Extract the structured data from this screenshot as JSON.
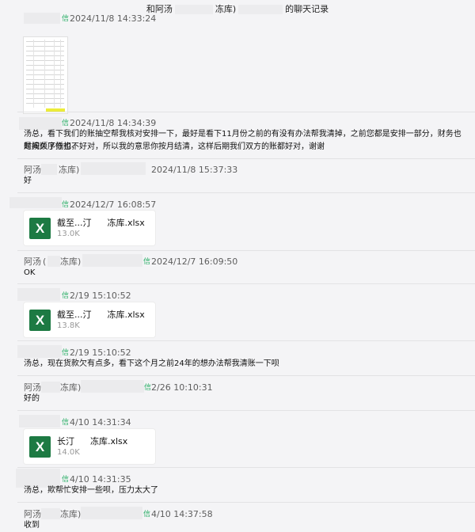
{
  "window": {
    "title": "和阿汤 冻库) 的聊天记录",
    "title_prefix": "和阿汤",
    "title_mid": "冻库)",
    "title_suffix": "的聊天记录"
  },
  "colors": {
    "background": "#f4f4f6",
    "file_icon": "#1d7a43",
    "wechat_tag": "#2aae67"
  },
  "messages": [
    {
      "id": "m1",
      "sender": "",
      "wx": "信",
      "time": "2024/11/8 14:33:24",
      "type": "image"
    },
    {
      "id": "m2",
      "sender": "",
      "wx": "信",
      "time": "2024/11/8 14:34:39",
      "type": "text",
      "line1": "汤总，看下我们的账抽空帮我核对安排一下，最好是看下11月份之前的有没有办法帮我清掉，之前您都是安排一部分，财务也是按顺序抵扣，",
      "line2": "时间久了你也不好对，所以我的意思你按月结清，这样后期我们双方的账都好对，谢谢"
    },
    {
      "id": "m3",
      "sender": "阿汤",
      "sender_mid": "冻库)",
      "time": "2024/11/8 15:37:33",
      "type": "text",
      "text": "好"
    },
    {
      "id": "m4",
      "sender": "",
      "wx": "信",
      "time": "2024/12/7 16:08:57",
      "type": "file",
      "file": {
        "name": "截至...汀",
        "name_end": "冻库.xlsx",
        "size": "13.0K",
        "icon": "X"
      }
    },
    {
      "id": "m5",
      "sender": "阿汤",
      "sender_mid": "(",
      "sender_mid2": "冻库)",
      "wx": "信",
      "time": "2024/12/7 16:09:50",
      "type": "text",
      "text": "OK"
    },
    {
      "id": "m6",
      "sender": "",
      "wx": "信",
      "time": "2/19 15:10:52",
      "type": "file",
      "file": {
        "name": "截至...汀",
        "name_end": "冻库.xlsx",
        "size": "13.8K",
        "icon": "X"
      }
    },
    {
      "id": "m7",
      "sender": "",
      "wx": "信",
      "time": "2/19 15:10:52",
      "type": "text",
      "text": "汤总，现在货款欠有点多，看下这个月之前24年的想办法帮我清账一下呗"
    },
    {
      "id": "m8",
      "sender": "阿汤",
      "sender_mid": "冻库)",
      "wx": "信",
      "time": "2/26 10:10:31",
      "type": "text",
      "text": "好的"
    },
    {
      "id": "m9",
      "sender": "",
      "wx": "信",
      "time": "4/10 14:31:34",
      "type": "file",
      "file": {
        "name": "长汀",
        "name_end": "冻库.xlsx",
        "size": "14.0K",
        "icon": "X"
      }
    },
    {
      "id": "m10",
      "sender": "",
      "wx": "信",
      "time": "4/10 14:31:35",
      "type": "text",
      "text": "汤总，欺帮忙安排一些呗，压力太大了"
    },
    {
      "id": "m11",
      "sender": "阿汤",
      "sender_mid": "冻库)",
      "wx": "信",
      "time": "4/10 14:37:58",
      "type": "text",
      "text": "收到"
    }
  ]
}
